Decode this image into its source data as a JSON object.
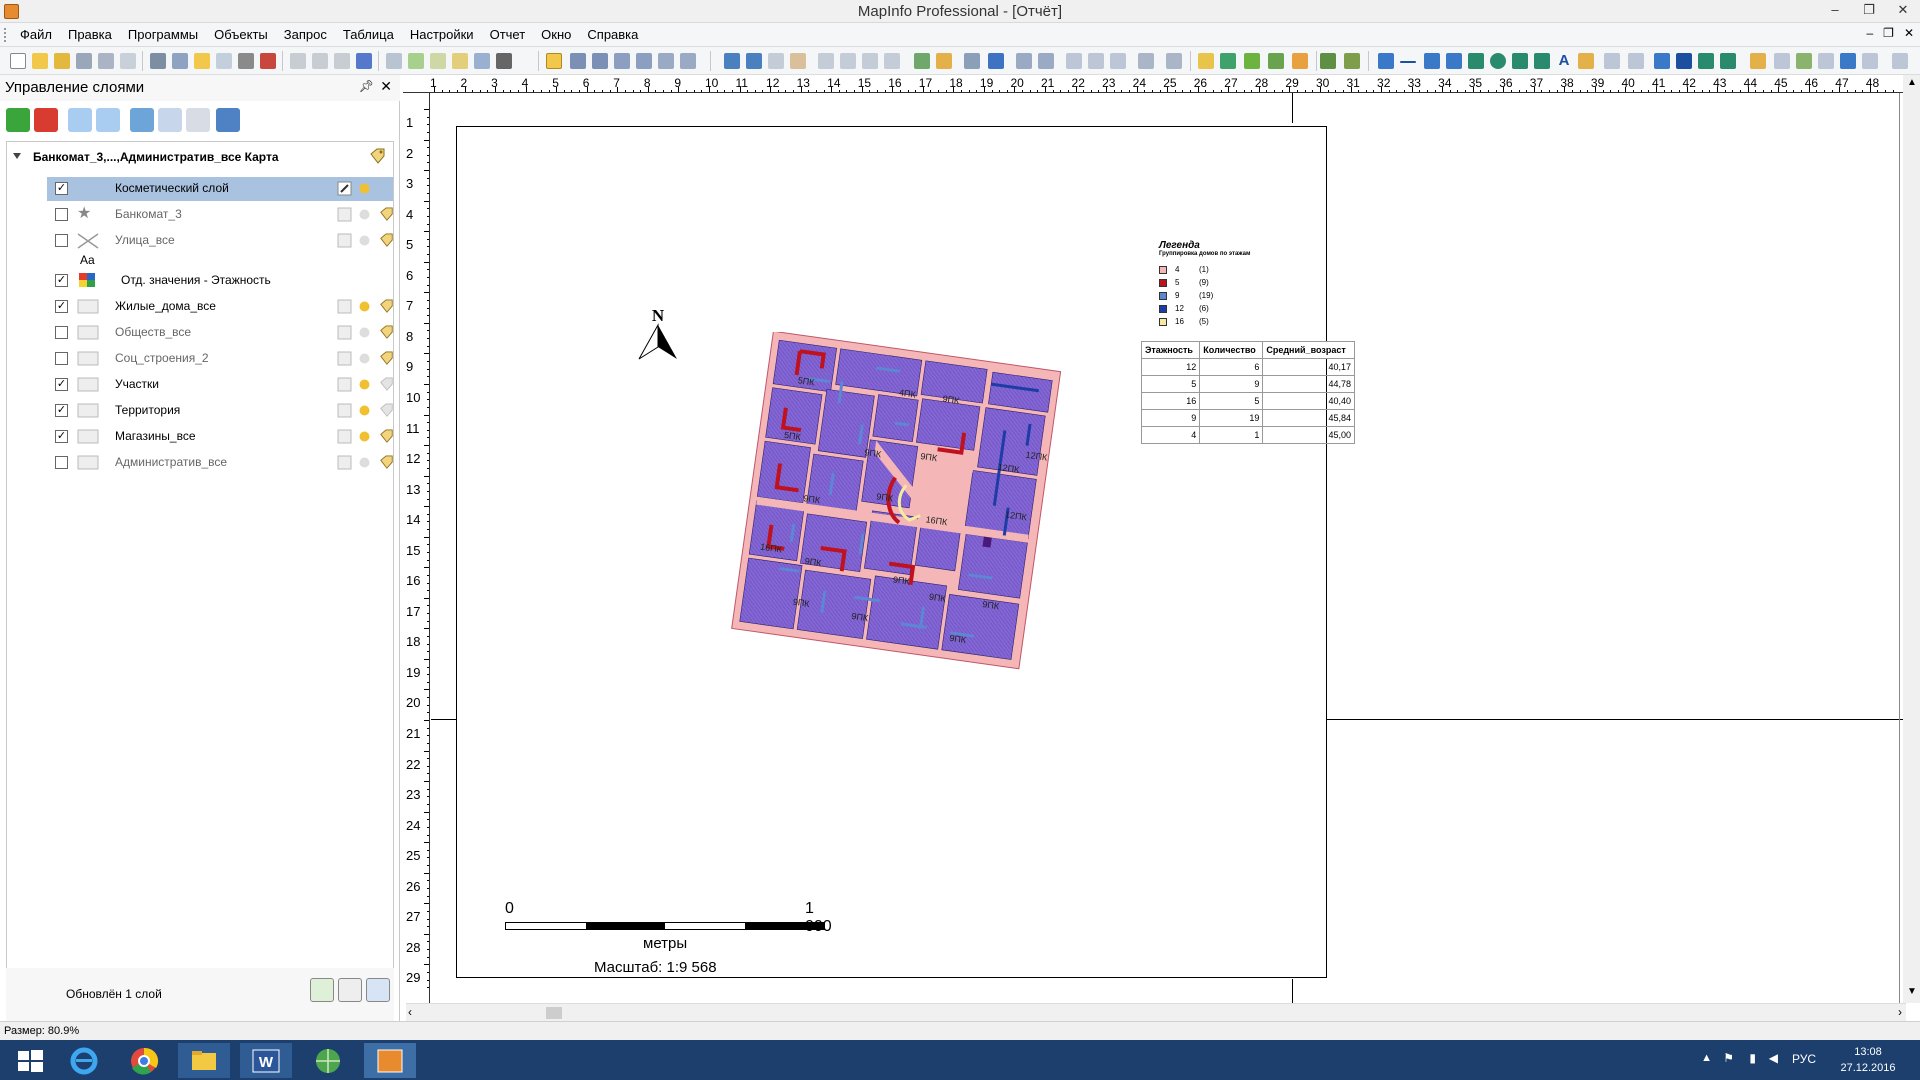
{
  "window": {
    "title": "MapInfo Professional - [Отчёт]",
    "controls": [
      "–",
      "❐",
      "✕"
    ]
  },
  "menu": [
    "Файл",
    "Правка",
    "Программы",
    "Объекты",
    "Запрос",
    "Таблица",
    "Настройки",
    "Отчет",
    "Окно",
    "Справка"
  ],
  "mdi_controls": [
    "–",
    "❐",
    "✕"
  ],
  "layer_panel": {
    "title": "Управление слоями",
    "root_label": "Банкомат_3,...,Административ_все Карта",
    "layers": [
      {
        "name": "Косметический слой",
        "checked": true,
        "selected": true,
        "icon": "cosmetic-layer-icon"
      },
      {
        "name": "Банкомат_3",
        "checked": false,
        "icon": "star-point-icon"
      },
      {
        "name": "Улица_все",
        "checked": false,
        "icon": "line-layer-icon",
        "sublabel": "Aa"
      },
      {
        "name": "Отд. значения - Этажность",
        "checked": true,
        "icon": "thematic-icon"
      },
      {
        "name": "Жилые_дома_все",
        "checked": true,
        "icon": "region-layer-icon"
      },
      {
        "name": "Обществ_все",
        "checked": false,
        "icon": "region-layer-icon"
      },
      {
        "name": "Соц_строения_2",
        "checked": false,
        "icon": "region-layer-icon"
      },
      {
        "name": "Участки",
        "checked": true,
        "icon": "region-layer-icon"
      },
      {
        "name": "Территория",
        "checked": true,
        "icon": "region-layer-icon"
      },
      {
        "name": "Магазины_все",
        "checked": true,
        "icon": "region-layer-icon"
      },
      {
        "name": "Административ_все",
        "checked": false,
        "icon": "region-layer-icon"
      }
    ],
    "status": "Обновлён 1 слой"
  },
  "ruler": {
    "top": [
      "1",
      "2",
      "3",
      "4",
      "5",
      "6",
      "7",
      "8",
      "9",
      "10",
      "11",
      "12",
      "13",
      "14",
      "15",
      "16",
      "17",
      "18",
      "19",
      "20",
      "21",
      "22",
      "23",
      "24",
      "25",
      "26",
      "27",
      "28",
      "29",
      "30",
      "31",
      "32",
      "33",
      "34",
      "35",
      "36",
      "37",
      "38",
      "39",
      "40",
      "41",
      "42",
      "43",
      "44",
      "45",
      "46",
      "47",
      "48"
    ],
    "left": [
      "1",
      "2",
      "3",
      "4",
      "5",
      "6",
      "7",
      "8",
      "9",
      "10",
      "11",
      "12",
      "13",
      "14",
      "15",
      "16",
      "17",
      "18",
      "19",
      "20",
      "21",
      "22",
      "23",
      "24",
      "25",
      "26",
      "27",
      "28",
      "29"
    ]
  },
  "layout": {
    "north": "N",
    "legend": {
      "title": "Легенда",
      "subtitle": "Группировка домов по этажам",
      "items": [
        {
          "value": "4",
          "count": "(1)",
          "color": "#f4b6b6"
        },
        {
          "value": "5",
          "count": "(9)",
          "color": "#c0121e"
        },
        {
          "value": "9",
          "count": "(19)",
          "color": "#5d86d4"
        },
        {
          "value": "12",
          "count": "(6)",
          "color": "#1c3da6"
        },
        {
          "value": "16",
          "count": "(5)",
          "color": "#f5eaa0"
        }
      ]
    },
    "table": {
      "headers": [
        "Этажность",
        "Количество",
        "Средний_возраст"
      ],
      "rows": [
        [
          "12",
          "6",
          "40,17"
        ],
        [
          "5",
          "9",
          "44,78"
        ],
        [
          "16",
          "5",
          "40,40"
        ],
        [
          "9",
          "19",
          "45,84"
        ],
        [
          "4",
          "1",
          "45,00"
        ]
      ]
    },
    "scale": {
      "zero": "0",
      "max": "1 000",
      "units": "метры",
      "text": "Масштаб: 1:9 568"
    }
  },
  "statusbar": {
    "size": "Размер: 80.9%"
  },
  "taskbar": {
    "lang": "РУС",
    "time": "13:08",
    "date": "27.12.2016"
  },
  "colors": {
    "territory": "#f4b6b6",
    "parcels": "#8467d4",
    "five_floor": "#c0121e",
    "nine_floor": "#5d86d4",
    "accent_selection": "#a8c2e0",
    "taskbar": "#1c3f6e"
  }
}
